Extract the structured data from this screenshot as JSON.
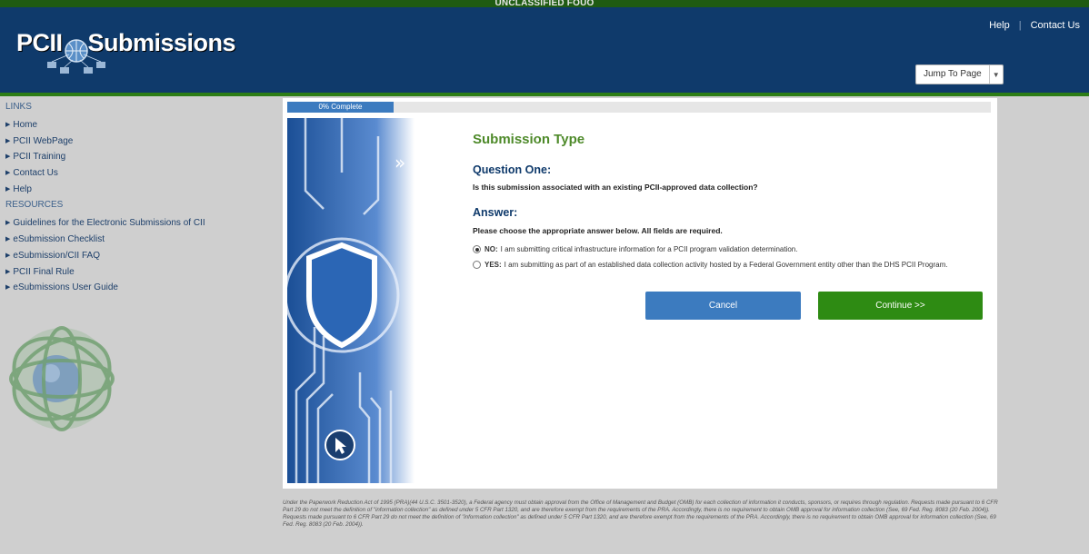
{
  "classification": "UNCLASSIFIED FOUO",
  "header": {
    "logo_left": "PCII",
    "logo_right": "Submissions",
    "links": [
      "Help",
      "Contact Us"
    ],
    "jump_label": "Jump To Page"
  },
  "sidebar": {
    "links_heading": "LINKS",
    "links": [
      "Home",
      "PCII WebPage",
      "PCII Training",
      "Contact Us",
      "Help"
    ],
    "resources_heading": "RESOURCES",
    "resources": [
      "Guidelines for the Electronic Submissions of CII",
      "eSubmission Checklist",
      "eSubmission/CII FAQ",
      "PCII Final Rule",
      "eSubmissions User Guide"
    ]
  },
  "progress": {
    "label": "0% Complete",
    "value": 0
  },
  "content": {
    "title": "Submission Type",
    "question_heading": "Question One:",
    "question_text": "Is this submission associated with an existing PCII-approved data collection?",
    "answer_heading": "Answer:",
    "answer_instructions": "Please choose the appropriate answer below. All fields are required.",
    "options": [
      {
        "key": "NO:",
        "text": "I am submitting critical infrastructure information for a PCII program validation determination.",
        "selected": true
      },
      {
        "key": "YES:",
        "text": "I am submitting as part of an established data collection activity hosted by a Federal Government entity other than the DHS PCII Program.",
        "selected": false
      }
    ],
    "cancel_label": "Cancel",
    "continue_label": "Continue >>"
  },
  "footer_text": "Under the Paperwork Reduction Act of 1995 (PRA)(44 U.S.C. 3501-3520), a Federal agency must obtain approval from the Office of Management and Budget (OMB) for each collection of information it conducts, sponsors, or requires through regulation. Requests made pursuant to 6 CFR Part 29 do not meet the definition of \"information collection\" as defined under 5 CFR Part 1320, and are therefore exempt from the requirements of the PRA. Accordingly, there is no requirement to obtain OMB approval for information collection (See, 69 Fed. Reg. 8083 (20 Feb. 2004)). Requests made pursuant to 6 CFR Part 29 do not meet the definition of \"information collection\" as defined under 5 CFR Part 1320, and are therefore exempt from the requirements of the PRA. Accordingly, there is no requirement to obtain OMB approval for information collection (See, 69 Fed. Reg. 8083 (20 Feb. 2004)).",
  "colors": {
    "header_blue": "#0f3a6b",
    "accent_green": "#2e8b13",
    "button_blue": "#3c7bbf",
    "title_green": "#4e8a2a"
  }
}
